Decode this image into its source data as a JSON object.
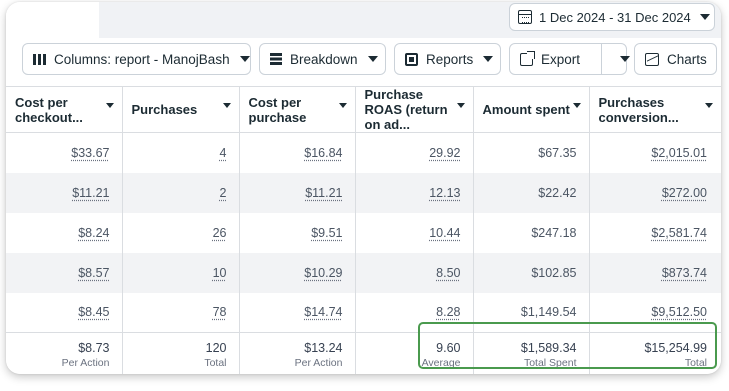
{
  "date_range": {
    "label": "1 Dec 2024 - 31 Dec 2024"
  },
  "toolbar": {
    "columns_label": "Columns: report - ManojBash",
    "breakdown_label": "Breakdown",
    "reports_label": "Reports",
    "export_label": "Export",
    "charts_label": "Charts"
  },
  "columns": [
    {
      "label": "Cost per checkout..."
    },
    {
      "label": "Purchases"
    },
    {
      "label": "Cost per purchase"
    },
    {
      "label": "Purchase ROAS (return on ad..."
    },
    {
      "label": "Amount spent"
    },
    {
      "label": "Purchases conversion..."
    }
  ],
  "rows": [
    [
      "$33.67",
      "4",
      "$16.84",
      "29.92",
      "$67.35",
      "$2,015.01"
    ],
    [
      "$11.21",
      "2",
      "$11.21",
      "12.13",
      "$22.42",
      "$272.00"
    ],
    [
      "$8.24",
      "26",
      "$9.51",
      "10.44",
      "$247.18",
      "$2,581.74"
    ],
    [
      "$8.57",
      "10",
      "$10.29",
      "8.50",
      "$102.85",
      "$873.74"
    ],
    [
      "$8.45",
      "78",
      "$14.74",
      "8.28",
      "$1,149.54",
      "$9,512.50"
    ]
  ],
  "totals": [
    {
      "value": "$8.73",
      "label": "Per Action"
    },
    {
      "value": "120",
      "label": "Total"
    },
    {
      "value": "$13.24",
      "label": "Per Action"
    },
    {
      "value": "9.60",
      "label": "Average"
    },
    {
      "value": "$1,589.34",
      "label": "Total Spent"
    },
    {
      "value": "$15,254.99",
      "label": "Total"
    }
  ],
  "colors": {
    "highlight": "#4a9a4e",
    "row_alt": "#f2f3f5",
    "border": "#dadde1"
  },
  "icons": [
    "calendar-icon",
    "columns-icon",
    "breakdown-icon",
    "reports-icon",
    "export-icon",
    "charts-icon",
    "chevron-down-icon"
  ]
}
